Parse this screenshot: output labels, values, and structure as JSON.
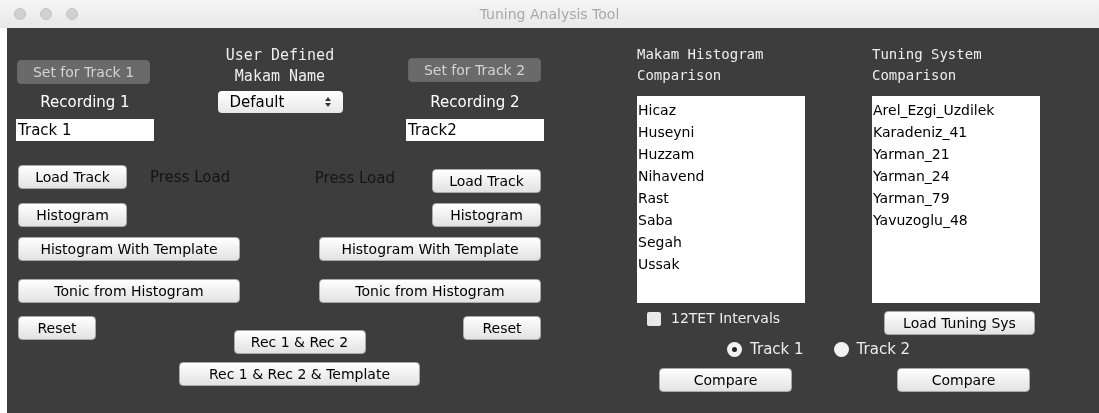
{
  "window": {
    "title": "Tuning Analysis Tool"
  },
  "recordings": [
    {
      "set_button": {
        "label": "Set for Track 1",
        "disabled": true
      },
      "label": "Recording 1",
      "track_name": "Track 1",
      "load_button": "Load Track",
      "status": "Press Load",
      "histogram_button": "Histogram",
      "template_button": "Histogram With Template",
      "tonic_button": "Tonic from Histogram",
      "reset_button": "Reset"
    },
    {
      "set_button": {
        "label": "Set for Track 2",
        "disabled": true
      },
      "label": "Recording 2",
      "track_name": "Track2",
      "load_button": "Load Track",
      "status": "Press Load",
      "histogram_button": "Histogram",
      "template_button": "Histogram With Template",
      "tonic_button": "Tonic from Histogram",
      "reset_button": "Reset"
    }
  ],
  "makam_name": {
    "title_lines": [
      "User Defined",
      "Makam Name"
    ],
    "select_value": "Default"
  },
  "combined_buttons": [
    "Rec 1 & Rec 2",
    "Rec 1 & Rec 2 & Template"
  ],
  "makam_comparison": {
    "title_lines": [
      "Makam Histogram",
      "Comparison"
    ],
    "items": [
      "Hicaz",
      "Huseyni",
      "Huzzam",
      "Nihavend",
      "Rast",
      "Saba",
      "Segah",
      "Ussak"
    ],
    "checkbox": {
      "label": "12TET Intervals",
      "checked": false
    },
    "compare_button": "Compare"
  },
  "tuning_comparison": {
    "title_lines": [
      "Tuning System",
      "Comparison"
    ],
    "items": [
      "Arel_Ezgi_Uzdilek",
      "Karadeniz_41",
      "Yarman_21",
      "Yarman_24",
      "Yarman_79",
      "Yavuzoglu_48"
    ],
    "load_button": "Load Tuning Sys",
    "compare_button": "Compare"
  },
  "track_radios": [
    {
      "label": "Track 1",
      "selected": true
    },
    {
      "label": "Track 2",
      "selected": false
    }
  ]
}
